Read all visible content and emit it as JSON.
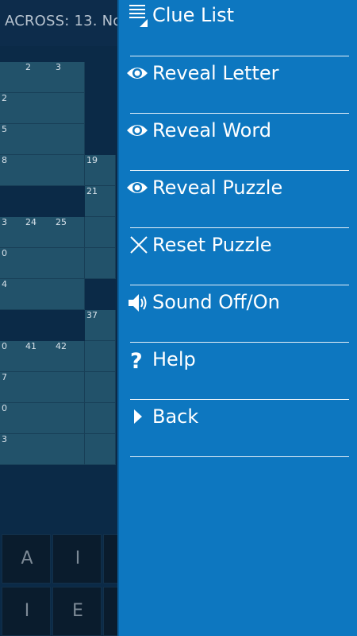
{
  "clue_bar": {
    "text": "ACROSS: 13. No"
  },
  "grid": {
    "cell_numbers": [
      "2",
      "3",
      "2",
      "5",
      "8",
      "19",
      "21",
      "3",
      "24",
      "25",
      "0",
      "4",
      "37",
      "0",
      "41",
      "42",
      "7",
      "0",
      "3"
    ]
  },
  "keyboard": {
    "keys": [
      "A",
      "I",
      "I",
      "E"
    ]
  },
  "menu": {
    "items": [
      {
        "label": "Clue List",
        "icon": "list-icon"
      },
      {
        "label": "Reveal Letter",
        "icon": "eye-icon"
      },
      {
        "label": "Reveal Word",
        "icon": "eye-icon"
      },
      {
        "label": "Reveal Puzzle",
        "icon": "eye-icon"
      },
      {
        "label": "Reset Puzzle",
        "icon": "close-icon"
      },
      {
        "label": "Sound Off/On",
        "icon": "speaker-icon"
      },
      {
        "label": "Help",
        "icon": "question-icon"
      },
      {
        "label": "Back",
        "icon": "play-icon"
      }
    ]
  },
  "colors": {
    "drawer": "#0d77c0",
    "grid_cell": "#22526a",
    "background": "#0b2a47",
    "text_on_menu": "#ffffff"
  }
}
